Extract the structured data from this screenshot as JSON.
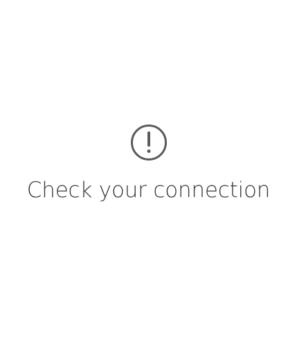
{
  "status": {
    "icon": "exclamation-circle-icon",
    "message": "Check your connection"
  },
  "colors": {
    "background": "#ffffff",
    "icon": "#5a5a5a",
    "text": "#3b3b3b"
  }
}
